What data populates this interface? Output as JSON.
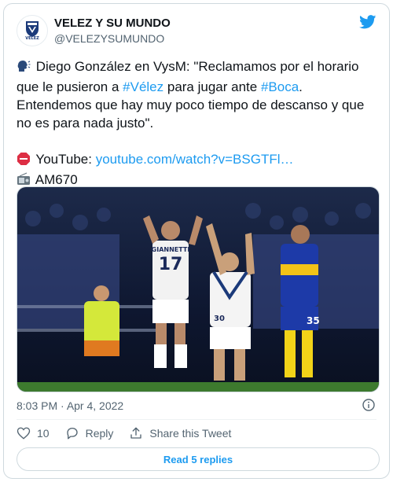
{
  "account": {
    "name": "VELEZ Y SU MUNDO",
    "handle": "@VELEZYSUMUNDO",
    "avatar_text": "VELEZ"
  },
  "tweet": {
    "line1_prefix": "Diego González en VysM: \"Reclamamos por el horario que le pusieron a ",
    "hashtag_velez": "#Vélez",
    "line1_mid": " para jugar ante ",
    "hashtag_boca": "#Boca",
    "line1_suffix": ". Entendemos que hay muy poco tiempo de descanso y que no es para nada justo\".",
    "youtube_label": "YouTube: ",
    "youtube_link": "youtube.com/watch?v=BSGTFl…",
    "radio_label": "AM670"
  },
  "photo": {
    "player1_name": "GIANNETTI",
    "player1_number": "17",
    "player2_number": "30",
    "player3_number": "35"
  },
  "meta": {
    "time": "8:03 PM",
    "separator": " · ",
    "date": "Apr 4, 2022"
  },
  "actions": {
    "likes": "10",
    "reply_label": "Reply",
    "share_label": "Share this Tweet"
  },
  "read_replies": "Read 5 replies",
  "colors": {
    "link": "#1d9bf0",
    "text": "#0f1419",
    "muted": "#536471",
    "like": "#f91880"
  }
}
